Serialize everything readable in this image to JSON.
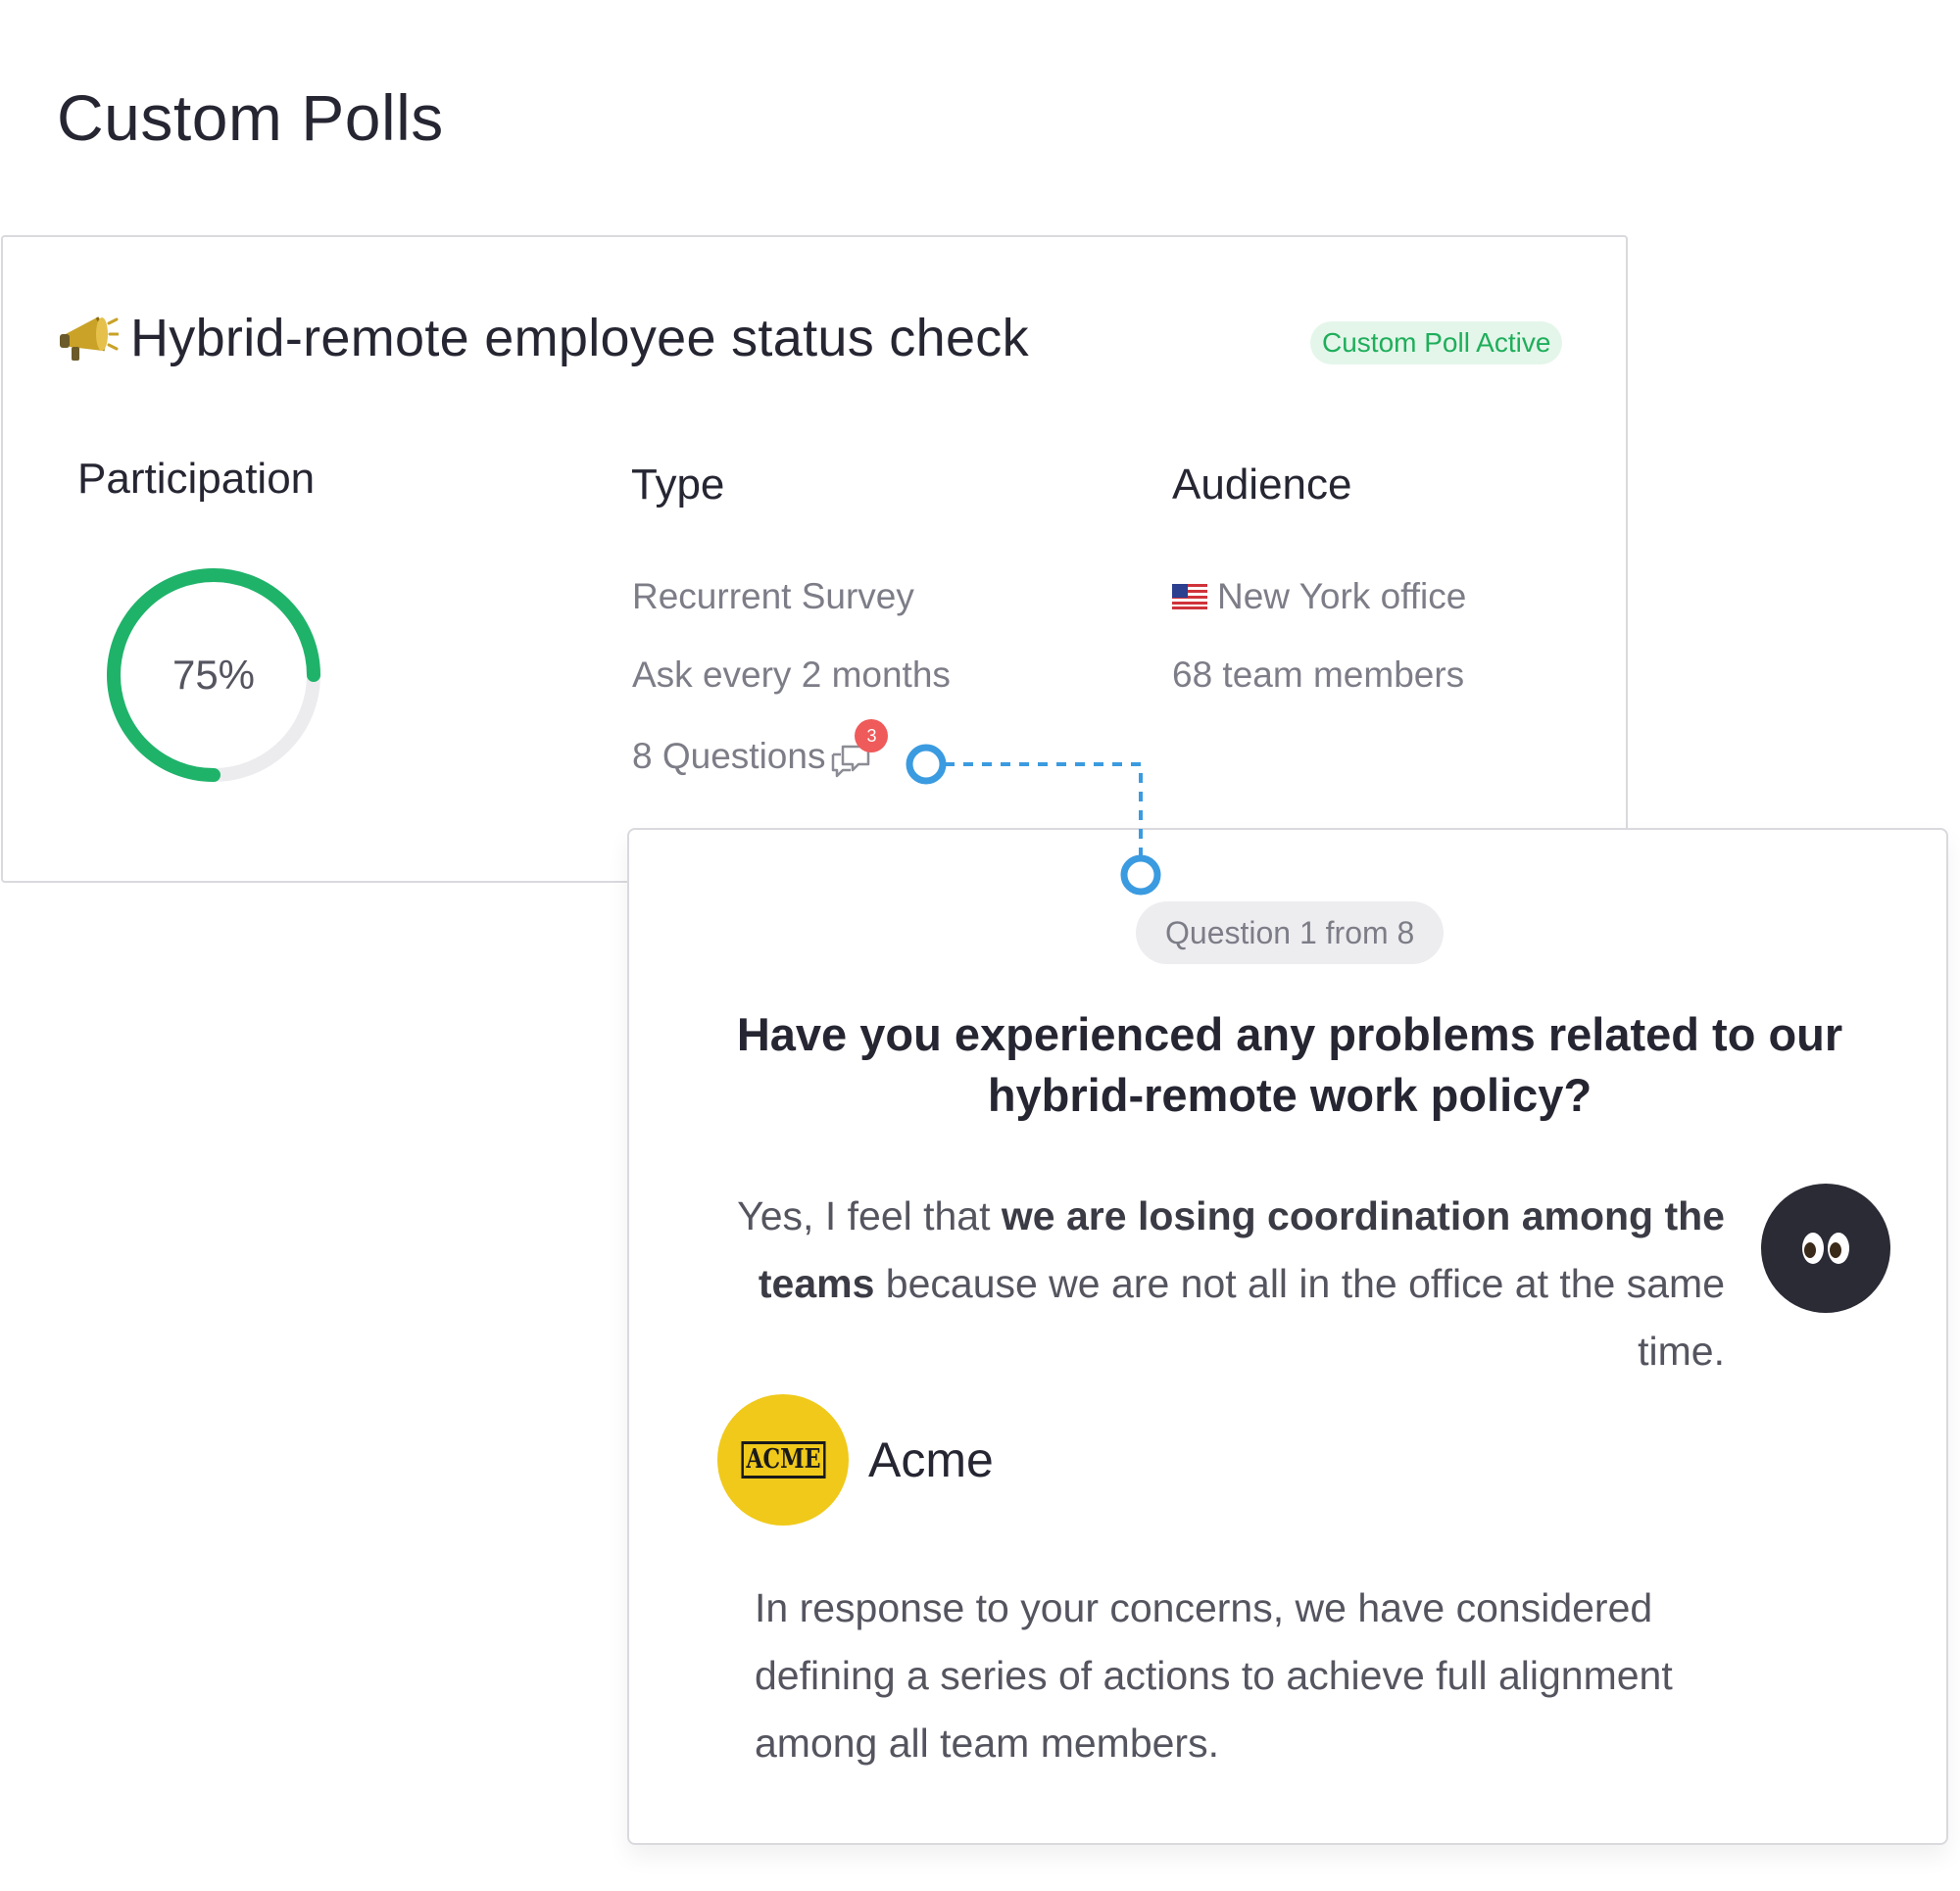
{
  "page": {
    "title": "Custom Polls"
  },
  "poll": {
    "title": "Hybrid-remote employee status check",
    "title_icon": "megaphone-icon",
    "status": "Custom Poll Active",
    "status_color": "#1fae5b",
    "participation": {
      "label": "Participation",
      "value_text": "75%",
      "fraction": 0.75,
      "color": "#1fb36a"
    },
    "type": {
      "label": "Type",
      "kind": "Recurrent Survey",
      "frequency": "Ask every 2 months",
      "questions": "8 Questions",
      "questions_icon": "chat-bubbles-icon",
      "unread_count": "3"
    },
    "audience": {
      "label": "Audience",
      "flag_icon": "us-flag-icon",
      "location": "New York office",
      "members": "68 team members"
    }
  },
  "question_card": {
    "progress": "Question 1 from 8",
    "question": "Have you experienced any problems related to our hybrid-remote work policy?",
    "answer": {
      "prefix": "Yes, I feel that ",
      "bold": "we are losing coordination among the teams",
      "suffix": " because we are not all in the office at the same time.",
      "avatar_icon": "eyes-icon"
    },
    "company": {
      "logo_text": "ACME",
      "name": "Acme",
      "logo_color": "#f0c91a"
    },
    "reply": "In response to your concerns, we have considered defining a series of actions to achieve full alignment among all team members."
  },
  "connector_color": "#3b9be0"
}
